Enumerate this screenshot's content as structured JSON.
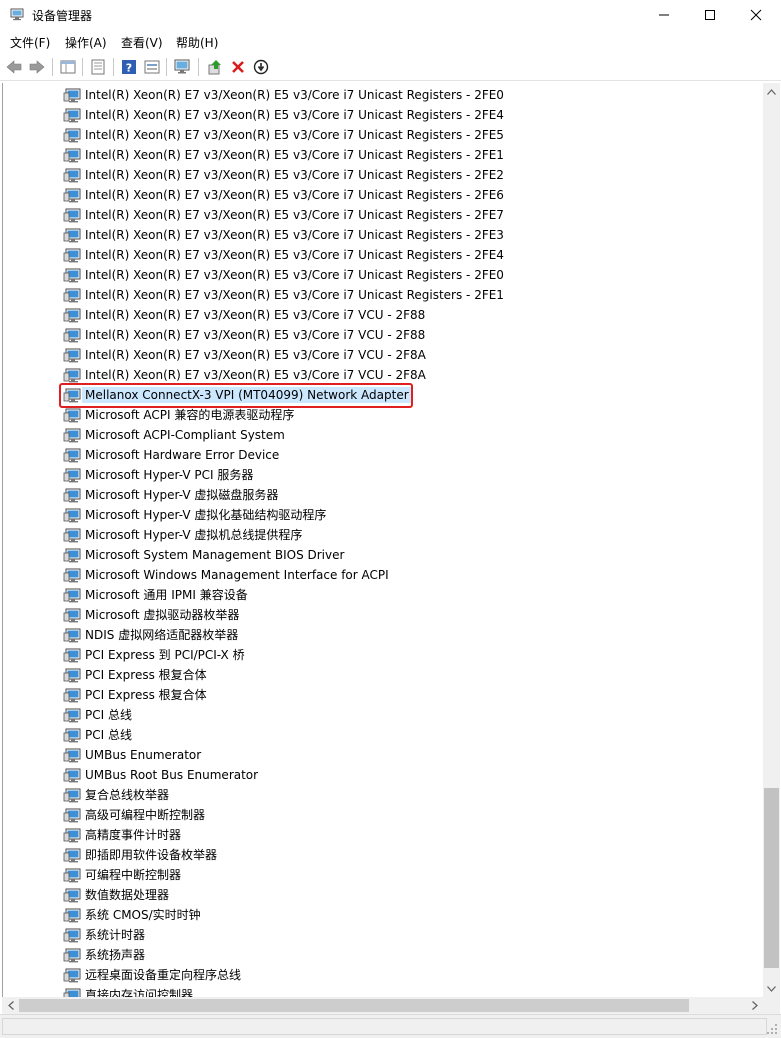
{
  "window": {
    "title": "设备管理器",
    "app_icon": "device-manager-icon",
    "buttons": {
      "minimize": "minimize-icon",
      "maximize": "maximize-icon",
      "close": "close-icon"
    }
  },
  "menu": [
    {
      "label": "文件(F)"
    },
    {
      "label": "操作(A)"
    },
    {
      "label": "查看(V)"
    },
    {
      "label": "帮助(H)"
    }
  ],
  "toolbar": [
    "back-arrow-icon",
    "forward-arrow-icon",
    "properties-pane-icon",
    "properties-icon",
    "help-icon",
    "show-hidden-icon",
    "scan-hardware-icon",
    "update-driver-icon",
    "uninstall-device-icon",
    "disable-device-icon"
  ],
  "devices": [
    {
      "label": "Intel(R) Xeon(R) E7 v3/Xeon(R) E5 v3/Core i7 Unicast Registers - 2FE0"
    },
    {
      "label": "Intel(R) Xeon(R) E7 v3/Xeon(R) E5 v3/Core i7 Unicast Registers - 2FE4"
    },
    {
      "label": "Intel(R) Xeon(R) E7 v3/Xeon(R) E5 v3/Core i7 Unicast Registers - 2FE5"
    },
    {
      "label": "Intel(R) Xeon(R) E7 v3/Xeon(R) E5 v3/Core i7 Unicast Registers - 2FE1"
    },
    {
      "label": "Intel(R) Xeon(R) E7 v3/Xeon(R) E5 v3/Core i7 Unicast Registers - 2FE2"
    },
    {
      "label": "Intel(R) Xeon(R) E7 v3/Xeon(R) E5 v3/Core i7 Unicast Registers - 2FE6"
    },
    {
      "label": "Intel(R) Xeon(R) E7 v3/Xeon(R) E5 v3/Core i7 Unicast Registers - 2FE7"
    },
    {
      "label": "Intel(R) Xeon(R) E7 v3/Xeon(R) E5 v3/Core i7 Unicast Registers - 2FE3"
    },
    {
      "label": "Intel(R) Xeon(R) E7 v3/Xeon(R) E5 v3/Core i7 Unicast Registers - 2FE4"
    },
    {
      "label": "Intel(R) Xeon(R) E7 v3/Xeon(R) E5 v3/Core i7 Unicast Registers - 2FE0"
    },
    {
      "label": "Intel(R) Xeon(R) E7 v3/Xeon(R) E5 v3/Core i7 Unicast Registers - 2FE1"
    },
    {
      "label": "Intel(R) Xeon(R) E7 v3/Xeon(R) E5 v3/Core i7 VCU - 2F88"
    },
    {
      "label": "Intel(R) Xeon(R) E7 v3/Xeon(R) E5 v3/Core i7 VCU - 2F88"
    },
    {
      "label": "Intel(R) Xeon(R) E7 v3/Xeon(R) E5 v3/Core i7 VCU - 2F8A"
    },
    {
      "label": "Intel(R) Xeon(R) E7 v3/Xeon(R) E5 v3/Core i7 VCU - 2F8A"
    },
    {
      "label": "Mellanox ConnectX-3 VPI (MT04099) Network Adapter",
      "selected": true
    },
    {
      "label": "Microsoft ACPI 兼容的电源表驱动程序"
    },
    {
      "label": "Microsoft ACPI-Compliant System"
    },
    {
      "label": "Microsoft Hardware Error Device"
    },
    {
      "label": "Microsoft Hyper-V PCI 服务器"
    },
    {
      "label": "Microsoft Hyper-V 虚拟磁盘服务器"
    },
    {
      "label": "Microsoft Hyper-V 虚拟化基础结构驱动程序"
    },
    {
      "label": "Microsoft Hyper-V 虚拟机总线提供程序"
    },
    {
      "label": "Microsoft System Management BIOS Driver"
    },
    {
      "label": "Microsoft Windows Management Interface for ACPI"
    },
    {
      "label": "Microsoft 通用 IPMI 兼容设备"
    },
    {
      "label": "Microsoft 虚拟驱动器枚举器"
    },
    {
      "label": "NDIS 虚拟网络适配器枚举器"
    },
    {
      "label": "PCI Express 到 PCI/PCI-X 桥"
    },
    {
      "label": "PCI Express 根复合体"
    },
    {
      "label": "PCI Express 根复合体"
    },
    {
      "label": "PCI 总线"
    },
    {
      "label": "PCI 总线"
    },
    {
      "label": "UMBus Enumerator"
    },
    {
      "label": "UMBus Root Bus Enumerator"
    },
    {
      "label": "复合总线枚举器"
    },
    {
      "label": "高级可编程中断控制器"
    },
    {
      "label": "高精度事件计时器"
    },
    {
      "label": "即插即用软件设备枚举器"
    },
    {
      "label": "可编程中断控制器"
    },
    {
      "label": "数值数据处理器"
    },
    {
      "label": "系统 CMOS/实时时钟"
    },
    {
      "label": "系统计时器"
    },
    {
      "label": "系统扬声器"
    },
    {
      "label": "远程桌面设备重定向程序总线"
    },
    {
      "label": "直接内存访问控制器"
    }
  ],
  "device_icon": "system-device-icon",
  "colors": {
    "selection": "#cce8ff",
    "annotation_box": "#e02020"
  }
}
